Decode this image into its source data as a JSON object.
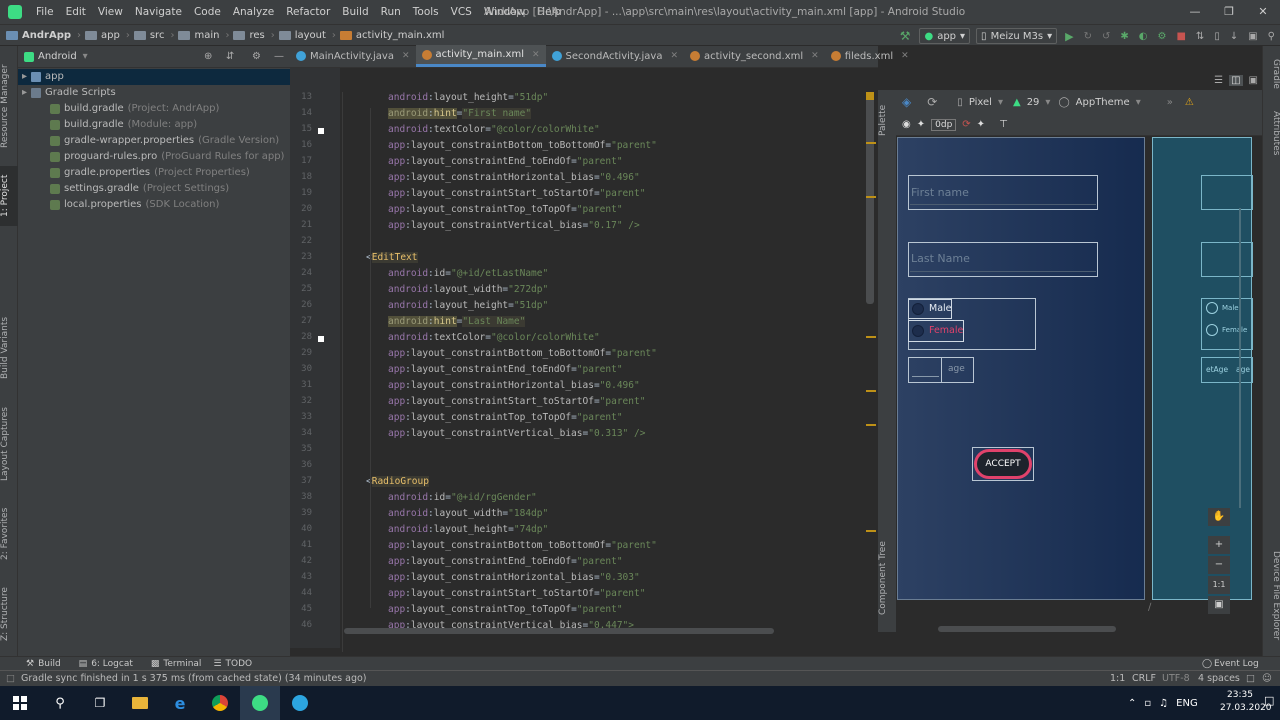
{
  "app": {
    "name": "AndrApp",
    "window_title": "AndrApp [D:\\AndrApp] - ...\\app\\src\\main\\res\\layout\\activity_main.xml [app] - Android Studio"
  },
  "menu": [
    "File",
    "Edit",
    "View",
    "Navigate",
    "Code",
    "Analyze",
    "Refactor",
    "Build",
    "Run",
    "Tools",
    "VCS",
    "Window",
    "Help"
  ],
  "breadcrumb": [
    "AndrApp",
    "app",
    "src",
    "main",
    "res",
    "layout",
    "activity_main.xml"
  ],
  "toolbar": {
    "run_config": "app",
    "device": "Meizu M3s"
  },
  "project": {
    "view": "Android",
    "items": [
      {
        "label": "app",
        "sub": "",
        "indent": 0
      },
      {
        "label": "Gradle Scripts",
        "sub": "",
        "indent": 0
      },
      {
        "label": "build.gradle",
        "sub": "(Project: AndrApp)",
        "indent": 1
      },
      {
        "label": "build.gradle",
        "sub": "(Module: app)",
        "indent": 1
      },
      {
        "label": "gradle-wrapper.properties",
        "sub": "(Gradle Version)",
        "indent": 1
      },
      {
        "label": "proguard-rules.pro",
        "sub": "(ProGuard Rules for app)",
        "indent": 1
      },
      {
        "label": "gradle.properties",
        "sub": "(Project Properties)",
        "indent": 1
      },
      {
        "label": "settings.gradle",
        "sub": "(Project Settings)",
        "indent": 1
      },
      {
        "label": "local.properties",
        "sub": "(SDK Location)",
        "indent": 1
      }
    ]
  },
  "left_tabs": [
    "Resource Manager",
    "1: Project",
    "Build Variants",
    "Layout Captures",
    "2: Favorites",
    "Z: Structure"
  ],
  "tabs": [
    {
      "label": "MainActivity.java",
      "active": false
    },
    {
      "label": "activity_main.xml",
      "active": true
    },
    {
      "label": "SecondActivity.java",
      "active": false
    },
    {
      "label": "activity_second.xml",
      "active": false
    },
    {
      "label": "fileds.xml",
      "active": false
    }
  ],
  "code_lines": [
    {
      "n": "13",
      "ns": "android",
      "attr": "layout_height",
      "val": "\"51dp\""
    },
    {
      "n": "14",
      "ns": "android",
      "attr": "hint",
      "val": "\"First name\"",
      "hl": true
    },
    {
      "n": "15",
      "ns": "android",
      "attr": "textColor",
      "val": "\"@color/colorWhite\""
    },
    {
      "n": "16",
      "ns": "app",
      "attr": "layout_constraintBottom_toBottomOf",
      "val": "\"parent\""
    },
    {
      "n": "17",
      "ns": "app",
      "attr": "layout_constraintEnd_toEndOf",
      "val": "\"parent\""
    },
    {
      "n": "18",
      "ns": "app",
      "attr": "layout_constraintHorizontal_bias",
      "val": "\"0.496\""
    },
    {
      "n": "19",
      "ns": "app",
      "attr": "layout_constraintStart_toStartOf",
      "val": "\"parent\""
    },
    {
      "n": "20",
      "ns": "app",
      "attr": "layout_constraintTop_toTopOf",
      "val": "\"parent\""
    },
    {
      "n": "21",
      "ns": "app",
      "attr": "layout_constraintVertical_bias",
      "val": "\"0.17\" />"
    },
    {
      "n": "22"
    },
    {
      "n": "23",
      "tag": "<EditText"
    },
    {
      "n": "24",
      "ns": "android",
      "attr": "id",
      "val": "\"@+id/etLastName\""
    },
    {
      "n": "25",
      "ns": "android",
      "attr": "layout_width",
      "val": "\"272dp\""
    },
    {
      "n": "26",
      "ns": "android",
      "attr": "layout_height",
      "val": "\"51dp\""
    },
    {
      "n": "27",
      "ns": "android",
      "attr": "hint",
      "val": "\"Last Name\"",
      "hl": true
    },
    {
      "n": "28",
      "ns": "android",
      "attr": "textColor",
      "val": "\"@color/colorWhite\""
    },
    {
      "n": "29",
      "ns": "app",
      "attr": "layout_constraintBottom_toBottomOf",
      "val": "\"parent\""
    },
    {
      "n": "30",
      "ns": "app",
      "attr": "layout_constraintEnd_toEndOf",
      "val": "\"parent\""
    },
    {
      "n": "31",
      "ns": "app",
      "attr": "layout_constraintHorizontal_bias",
      "val": "\"0.496\""
    },
    {
      "n": "32",
      "ns": "app",
      "attr": "layout_constraintStart_toStartOf",
      "val": "\"parent\""
    },
    {
      "n": "33",
      "ns": "app",
      "attr": "layout_constraintTop_toTopOf",
      "val": "\"parent\""
    },
    {
      "n": "34",
      "ns": "app",
      "attr": "layout_constraintVertical_bias",
      "val": "\"0.313\" />"
    },
    {
      "n": "35"
    },
    {
      "n": "36"
    },
    {
      "n": "37",
      "tag": "<RadioGroup"
    },
    {
      "n": "38",
      "ns": "android",
      "attr": "id",
      "val": "\"@+id/rgGender\""
    },
    {
      "n": "39",
      "ns": "android",
      "attr": "layout_width",
      "val": "\"184dp\""
    },
    {
      "n": "40",
      "ns": "android",
      "attr": "layout_height",
      "val": "\"74dp\""
    },
    {
      "n": "41",
      "ns": "app",
      "attr": "layout_constraintBottom_toBottomOf",
      "val": "\"parent\""
    },
    {
      "n": "42",
      "ns": "app",
      "attr": "layout_constraintEnd_toEndOf",
      "val": "\"parent\""
    },
    {
      "n": "43",
      "ns": "app",
      "attr": "layout_constraintHorizontal_bias",
      "val": "\"0.303\""
    },
    {
      "n": "44",
      "ns": "app",
      "attr": "layout_constraintStart_toStartOf",
      "val": "\"parent\""
    },
    {
      "n": "45",
      "ns": "app",
      "attr": "layout_constraintTop_toTopOf",
      "val": "\"parent\""
    },
    {
      "n": "46",
      "ns": "app",
      "attr": "layout_constraintVertical_bias",
      "val": "\"0.447\">"
    }
  ],
  "designer": {
    "device": "Pixel",
    "api": "29",
    "theme": "AppTheme",
    "margin": "0dp",
    "palette": "Palette",
    "component_tree": "Component Tree",
    "attributes": "Attributes",
    "device_file_explorer": "Device File Explorer",
    "gradle": "Gradle",
    "zoom_fit": "1:1"
  },
  "preview": {
    "first_name": "First name",
    "last_name": "Last Name",
    "male": "Male",
    "female": "Female",
    "age": "age",
    "accept": "ACCEPT",
    "blueprint_male": "Male",
    "blueprint_female": "Female",
    "blueprint_etage": "etAge",
    "blueprint_age": "age"
  },
  "bottom_tabs": [
    "Build",
    "6: Logcat",
    "Terminal",
    "TODO"
  ],
  "event_log": "Event Log",
  "status": {
    "message": "Gradle sync finished in 1 s 375 ms (from cached state) (34 minutes ago)",
    "position": "1:1",
    "line_ending": "CRLF",
    "encoding": "UTF-8",
    "indent": "4 spaces"
  },
  "taskbar": {
    "time": "23:35",
    "date": "27.03.2020",
    "lang": "ENG"
  },
  "colors": {
    "accent": "#4a88c7",
    "xml_tag": "#e8bf6a",
    "xml_value": "#6a8759",
    "namespace": "#9876aa",
    "accept_border": "#e0426b",
    "female_text": "#e0426b"
  }
}
